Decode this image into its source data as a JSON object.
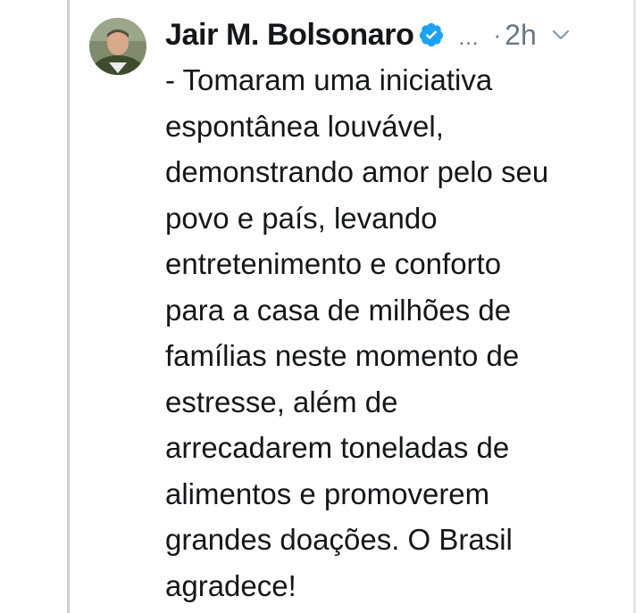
{
  "tweet": {
    "author_name": "Jair M. Bolsonaro",
    "verified_icon": "verified-badge-icon",
    "handle_truncated": "…",
    "separator": "·",
    "time_ago": "2h",
    "menu_icon": "chevron-down-icon",
    "text": "- Tomaram uma iniciativa\nespontânea louvável,\ndemonstrando amor pelo seu\npovo e país, levando\nentretenimento e conforto\npara a casa de milhões de\nfamílias neste momento de\nestresse, além de\narrecadarem toneladas de\nalimentos e promoverem\ngrandes doações. O Brasil\nagradece!"
  },
  "colors": {
    "text_primary": "#14171a",
    "text_secondary": "#657786",
    "verified_blue": "#1da1f2",
    "thread_line": "#c8d3dc"
  }
}
